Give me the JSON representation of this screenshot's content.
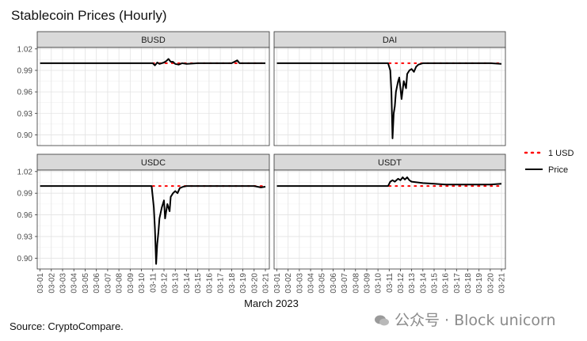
{
  "title": "Stablecoin Prices (Hourly)",
  "source": "Source: CryptoCompare.",
  "watermark": "公众号 · Block unicorn",
  "chart_data": {
    "type": "line",
    "layout": "facet-2x2",
    "xlabel": "March 2023",
    "x_ticks": [
      "03-01",
      "03-02",
      "03-03",
      "03-04",
      "03-05",
      "03-06",
      "03-07",
      "03-08",
      "03-09",
      "03-10",
      "03-11",
      "03-12",
      "03-13",
      "03-14",
      "03-15",
      "03-16",
      "03-17",
      "03-18",
      "03-19",
      "03-20",
      "03-21"
    ],
    "ylim": [
      0.885,
      1.022
    ],
    "y_ticks": [
      "1.02",
      "0.99",
      "0.96",
      "0.93",
      "0.90"
    ],
    "y_tick_values": [
      1.02,
      0.99,
      0.96,
      0.93,
      0.9
    ],
    "grid": true,
    "legend": {
      "placement": "right",
      "entries": [
        {
          "label": "1 USD",
          "color": "#ff0000",
          "style": "dotted"
        },
        {
          "label": "Price",
          "color": "#000000",
          "style": "solid"
        }
      ]
    },
    "reference_line": 1.0,
    "panels": [
      {
        "name": "BUSD",
        "series": [
          {
            "x": 1.0,
            "y": 1.0
          },
          {
            "x": 3.0,
            "y": 1.0
          },
          {
            "x": 5.0,
            "y": 1.0
          },
          {
            "x": 7.0,
            "y": 1.0
          },
          {
            "x": 9.0,
            "y": 1.0
          },
          {
            "x": 11.0,
            "y": 1.0
          },
          {
            "x": 11.2,
            "y": 0.997
          },
          {
            "x": 11.4,
            "y": 1.001
          },
          {
            "x": 11.6,
            "y": 0.999
          },
          {
            "x": 12.0,
            "y": 1.001
          },
          {
            "x": 12.2,
            "y": 1.003
          },
          {
            "x": 12.4,
            "y": 1.006
          },
          {
            "x": 12.6,
            "y": 1.002
          },
          {
            "x": 12.8,
            "y": 1.002
          },
          {
            "x": 13.0,
            "y": 0.999
          },
          {
            "x": 13.3,
            "y": 0.998
          },
          {
            "x": 13.6,
            "y": 1.0
          },
          {
            "x": 14.0,
            "y": 0.999
          },
          {
            "x": 15.0,
            "y": 1.0
          },
          {
            "x": 16.0,
            "y": 1.0
          },
          {
            "x": 17.0,
            "y": 1.0
          },
          {
            "x": 18.0,
            "y": 1.0
          },
          {
            "x": 18.5,
            "y": 1.004
          },
          {
            "x": 18.7,
            "y": 1.0
          },
          {
            "x": 19.0,
            "y": 1.0
          },
          {
            "x": 20.0,
            "y": 1.0
          },
          {
            "x": 21.0,
            "y": 1.0
          }
        ]
      },
      {
        "name": "DAI",
        "series": [
          {
            "x": 1.0,
            "y": 1.0
          },
          {
            "x": 3.0,
            "y": 1.0
          },
          {
            "x": 5.0,
            "y": 1.0
          },
          {
            "x": 7.0,
            "y": 1.0
          },
          {
            "x": 9.0,
            "y": 1.0
          },
          {
            "x": 10.9,
            "y": 1.0
          },
          {
            "x": 11.1,
            "y": 0.99
          },
          {
            "x": 11.2,
            "y": 0.96
          },
          {
            "x": 11.3,
            "y": 0.895
          },
          {
            "x": 11.4,
            "y": 0.93
          },
          {
            "x": 11.5,
            "y": 0.94
          },
          {
            "x": 11.6,
            "y": 0.96
          },
          {
            "x": 11.8,
            "y": 0.975
          },
          {
            "x": 11.9,
            "y": 0.98
          },
          {
            "x": 12.0,
            "y": 0.965
          },
          {
            "x": 12.1,
            "y": 0.95
          },
          {
            "x": 12.3,
            "y": 0.975
          },
          {
            "x": 12.5,
            "y": 0.965
          },
          {
            "x": 12.6,
            "y": 0.985
          },
          {
            "x": 12.8,
            "y": 0.99
          },
          {
            "x": 13.0,
            "y": 0.992
          },
          {
            "x": 13.2,
            "y": 0.988
          },
          {
            "x": 13.4,
            "y": 0.995
          },
          {
            "x": 13.6,
            "y": 0.998
          },
          {
            "x": 14.0,
            "y": 1.0
          },
          {
            "x": 16.0,
            "y": 1.0
          },
          {
            "x": 18.0,
            "y": 1.0
          },
          {
            "x": 20.0,
            "y": 1.0
          },
          {
            "x": 21.0,
            "y": 0.999
          }
        ]
      },
      {
        "name": "USDC",
        "series": [
          {
            "x": 1.0,
            "y": 1.0
          },
          {
            "x": 3.0,
            "y": 1.0
          },
          {
            "x": 5.0,
            "y": 1.0
          },
          {
            "x": 7.0,
            "y": 1.0
          },
          {
            "x": 9.0,
            "y": 1.0
          },
          {
            "x": 10.9,
            "y": 1.0
          },
          {
            "x": 11.1,
            "y": 0.97
          },
          {
            "x": 11.2,
            "y": 0.94
          },
          {
            "x": 11.3,
            "y": 0.892
          },
          {
            "x": 11.4,
            "y": 0.92
          },
          {
            "x": 11.5,
            "y": 0.935
          },
          {
            "x": 11.6,
            "y": 0.955
          },
          {
            "x": 11.8,
            "y": 0.97
          },
          {
            "x": 12.0,
            "y": 0.98
          },
          {
            "x": 12.1,
            "y": 0.955
          },
          {
            "x": 12.3,
            "y": 0.975
          },
          {
            "x": 12.5,
            "y": 0.965
          },
          {
            "x": 12.6,
            "y": 0.985
          },
          {
            "x": 12.8,
            "y": 0.99
          },
          {
            "x": 13.0,
            "y": 0.993
          },
          {
            "x": 13.2,
            "y": 0.99
          },
          {
            "x": 13.4,
            "y": 0.997
          },
          {
            "x": 13.7,
            "y": 0.999
          },
          {
            "x": 14.0,
            "y": 1.0
          },
          {
            "x": 16.0,
            "y": 1.0
          },
          {
            "x": 18.0,
            "y": 1.0
          },
          {
            "x": 20.0,
            "y": 1.0
          },
          {
            "x": 20.6,
            "y": 0.998
          },
          {
            "x": 21.0,
            "y": 0.999
          }
        ]
      },
      {
        "name": "USDT",
        "series": [
          {
            "x": 1.0,
            "y": 1.0
          },
          {
            "x": 3.0,
            "y": 1.0
          },
          {
            "x": 5.0,
            "y": 1.0
          },
          {
            "x": 7.0,
            "y": 1.0
          },
          {
            "x": 9.0,
            "y": 1.0
          },
          {
            "x": 10.9,
            "y": 1.0
          },
          {
            "x": 11.1,
            "y": 1.006
          },
          {
            "x": 11.3,
            "y": 1.008
          },
          {
            "x": 11.5,
            "y": 1.006
          },
          {
            "x": 11.8,
            "y": 1.01
          },
          {
            "x": 12.0,
            "y": 1.008
          },
          {
            "x": 12.2,
            "y": 1.012
          },
          {
            "x": 12.4,
            "y": 1.009
          },
          {
            "x": 12.6,
            "y": 1.012
          },
          {
            "x": 12.8,
            "y": 1.008
          },
          {
            "x": 13.0,
            "y": 1.006
          },
          {
            "x": 13.5,
            "y": 1.005
          },
          {
            "x": 14.0,
            "y": 1.004
          },
          {
            "x": 15.0,
            "y": 1.003
          },
          {
            "x": 16.0,
            "y": 1.002
          },
          {
            "x": 17.0,
            "y": 1.002
          },
          {
            "x": 18.0,
            "y": 1.002
          },
          {
            "x": 19.0,
            "y": 1.002
          },
          {
            "x": 20.0,
            "y": 1.002
          },
          {
            "x": 21.0,
            "y": 1.003
          }
        ]
      }
    ]
  }
}
